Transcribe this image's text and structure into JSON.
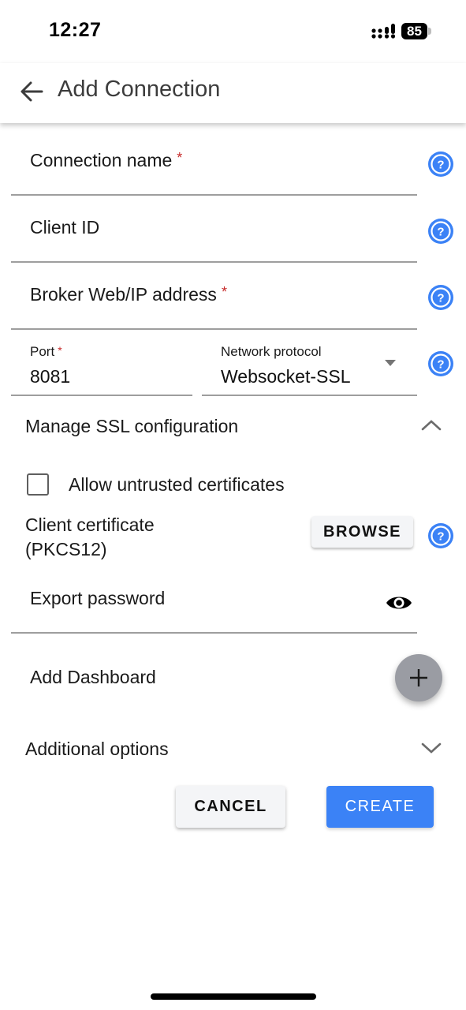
{
  "status_bar": {
    "time": "12:27",
    "battery": "85"
  },
  "app_bar": {
    "title": "Add Connection",
    "back_icon": "arrow-left-icon"
  },
  "form": {
    "connection_name": {
      "label": "Connection name",
      "required_mark": "*",
      "value": ""
    },
    "client_id": {
      "label": "Client ID",
      "value": ""
    },
    "broker_address": {
      "label": "Broker Web/IP address",
      "required_mark": "*",
      "value": ""
    },
    "port": {
      "label": "Port",
      "required_mark": "*",
      "value": "8081"
    },
    "network_protocol": {
      "label": "Network protocol",
      "value": "Websocket-SSL"
    },
    "help_icon": "help-circle-icon"
  },
  "ssl_section": {
    "title": "Manage SSL configuration",
    "expanded": true,
    "allow_untrusted": {
      "label": "Allow untrusted certificates",
      "checked": false
    },
    "client_certificate": {
      "label": "Client certificate (PKCS12)",
      "button": "BROWSE"
    },
    "export_password": {
      "label": "Export password",
      "value": ""
    }
  },
  "dashboard": {
    "label": "Add Dashboard"
  },
  "additional_options": {
    "title": "Additional options",
    "expanded": false
  },
  "actions": {
    "cancel": "CANCEL",
    "create": "CREATE"
  },
  "colors": {
    "accent": "#3b82f6",
    "help_icon": "#3b82f6",
    "required": "#c62828",
    "fab": "#9a9ca3"
  }
}
